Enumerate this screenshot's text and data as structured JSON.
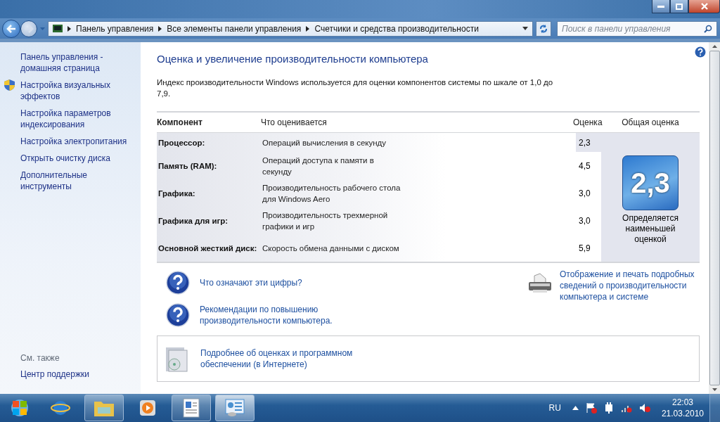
{
  "address_bar": {
    "crumbs": [
      "Панель управления",
      "Все элементы панели управления",
      "Счетчики и средства производительности"
    ],
    "search_placeholder": "Поиск в панели управления"
  },
  "sidebar": {
    "items": [
      {
        "label": "Панель управления - домашняя страница",
        "shield": false
      },
      {
        "label": "Настройка визуальных эффектов",
        "shield": true
      },
      {
        "label": "Настройка параметров индексирования",
        "shield": false
      },
      {
        "label": "Настройка электропитания",
        "shield": false
      },
      {
        "label": "Открыть очистку диска",
        "shield": false
      },
      {
        "label": "Дополнительные инструменты",
        "shield": false
      }
    ],
    "see_also_title": "См. также",
    "see_also": [
      "Центр поддержки"
    ]
  },
  "main": {
    "title": "Оценка и увеличение производительности компьютера",
    "description": "Индекс производительности Windows используется для оценки компонентов системы по шкале от 1,0 до 7,9.",
    "table": {
      "columns": [
        "Компонент",
        "Что оценивается",
        "Оценка",
        "Общая оценка"
      ],
      "rows": [
        {
          "component": "Процессор:",
          "measures": "Операций вычисления в секунду",
          "score": "2,3",
          "lowest": true
        },
        {
          "component": "Память (RAM):",
          "measures": "Операций доступа к памяти в секунду",
          "score": "4,5",
          "lowest": false
        },
        {
          "component": "Графика:",
          "measures": "Производительность рабочего стола для Windows Aero",
          "score": "3,0",
          "lowest": false
        },
        {
          "component": "Графика для игр:",
          "measures": "Производительность трехмерной графики и игр",
          "score": "3,0",
          "lowest": false
        },
        {
          "component": "Основной жесткий диск:",
          "measures": "Скорость обмена данными с диском",
          "score": "5,9",
          "lowest": false
        }
      ],
      "base_score": "2,3",
      "base_note": "Определяется наименьшей оценкой"
    },
    "help_links": [
      "Что означают эти цифры?",
      "Рекомендации по повышению производительности компьютера."
    ],
    "print_link": "Отображение и печать подробных сведений о производительности компьютера и системе",
    "online_link": "Подробнее об оценках и программном обеспечении (в Интернете)"
  },
  "taskbar": {
    "apps": [
      {
        "kind": "browser",
        "running": false,
        "selected": false
      },
      {
        "kind": "folder",
        "running": true,
        "selected": false
      },
      {
        "kind": "media",
        "running": false,
        "selected": false
      },
      {
        "kind": "document",
        "running": true,
        "selected": false
      },
      {
        "kind": "panel",
        "running": true,
        "selected": true
      }
    ],
    "language": "RU",
    "time": "22:03",
    "date": "21.03.2010"
  }
}
